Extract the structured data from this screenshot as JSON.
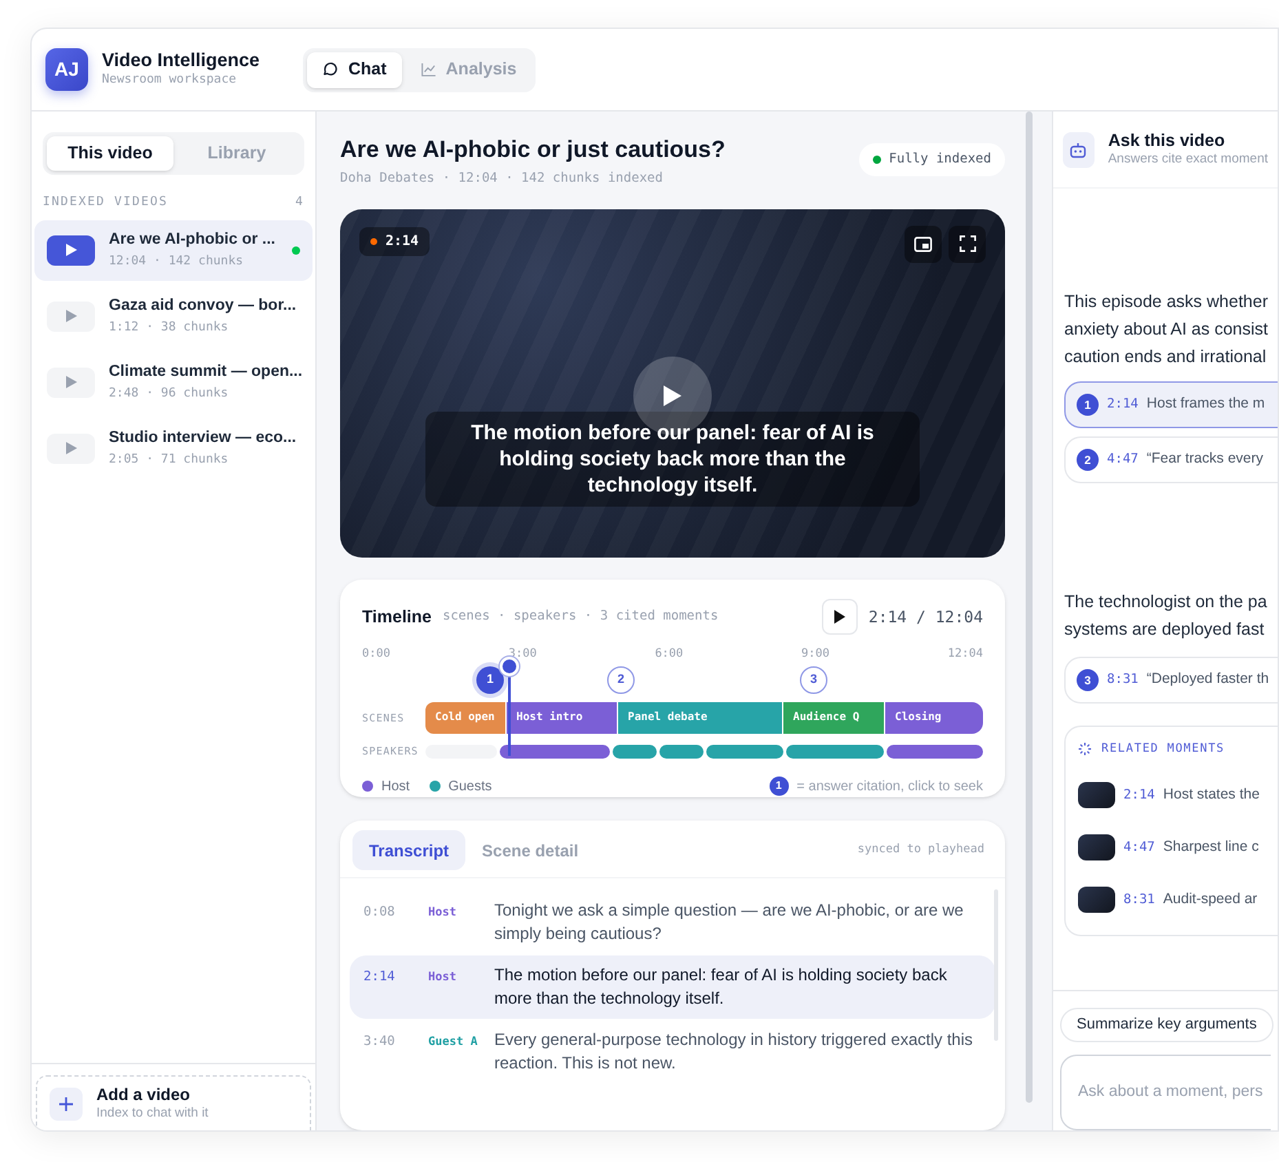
{
  "header": {
    "logo": "AJ",
    "title": "Video Intelligence",
    "subtitle": "Newsroom workspace",
    "tabs": [
      {
        "label": "Chat",
        "selected": true
      },
      {
        "label": "Analysis",
        "selected": false
      }
    ]
  },
  "sidebar": {
    "segments": [
      {
        "label": "This video",
        "selected": true
      },
      {
        "label": "Library",
        "selected": false
      }
    ],
    "section_title": "INDEXED VIDEOS",
    "count": "4",
    "videos": [
      {
        "title": "Are we AI-phobic or ...",
        "meta": "12:04 · 142 chunks",
        "selected": true
      },
      {
        "title": "Gaza aid convoy — bor...",
        "meta": "1:12 · 38 chunks",
        "selected": false
      },
      {
        "title": "Climate summit — open...",
        "meta": "2:48 · 96 chunks",
        "selected": false
      },
      {
        "title": "Studio interview — eco...",
        "meta": "2:05 · 71 chunks",
        "selected": false
      }
    ],
    "add": {
      "title": "Add a video",
      "subtitle": "Index to chat with it"
    }
  },
  "video": {
    "title": "Are we AI-phobic or just cautious?",
    "meta": "Doha Debates · 12:04 · 142 chunks indexed",
    "status": "Fully indexed",
    "timestamp": "2:14",
    "caption": "The motion before our panel: fear of AI is holding society back more than the technology itself."
  },
  "timeline": {
    "title": "Timeline",
    "summary": "scenes · speakers · 3 cited moments",
    "time": "2:14 / 12:04",
    "ticks": [
      "0:00",
      "3:00",
      "6:00",
      "9:00",
      "12:04"
    ],
    "scenes_label": "SCENES",
    "speakers_label": "SPEAKERS",
    "scenes": [
      {
        "label": "Cold open",
        "color": "#e48b4a"
      },
      {
        "label": "Host intro",
        "color": "#7b5fd6"
      },
      {
        "label": "Panel debate",
        "color": "#27a4a8"
      },
      {
        "label": "Audience Q",
        "color": "#2fa65c"
      },
      {
        "label": "Closing",
        "color": "#7b5fd6"
      }
    ],
    "speaker_segments": [
      {
        "kind": "none"
      },
      {
        "kind": "host"
      },
      {
        "kind": "guest"
      },
      {
        "kind": "guest"
      },
      {
        "kind": "guest"
      },
      {
        "kind": "guest"
      },
      {
        "kind": "host"
      }
    ],
    "markers": [
      {
        "label": "1",
        "selected": true
      },
      {
        "label": "2",
        "selected": false
      },
      {
        "label": "3",
        "selected": false
      }
    ],
    "legend": [
      {
        "label": "Host",
        "color": "#7b5fd6"
      },
      {
        "label": "Guests",
        "color": "#27a4a8"
      }
    ],
    "hint_marker": "1",
    "hint": "= answer citation, click to seek"
  },
  "transcript": {
    "tabs": [
      {
        "label": "Transcript",
        "selected": true
      },
      {
        "label": "Scene detail",
        "selected": false
      }
    ],
    "sync_note": "synced to playhead",
    "rows": [
      {
        "time": "0:08",
        "speaker": "Host",
        "kind": "host",
        "text": "Tonight we ask a simple question — are we AI-phobic, or are we simply being cautious?",
        "selected": false
      },
      {
        "time": "2:14",
        "speaker": "Host",
        "kind": "host",
        "text": "The motion before our panel: fear of AI is holding society back more than the technology itself.",
        "selected": true
      },
      {
        "time": "3:40",
        "speaker": "Guest A",
        "kind": "guest",
        "text": "Every general-purpose technology in history triggered exactly this reaction. This is not new.",
        "selected": false
      }
    ]
  },
  "chat": {
    "title": "Ask this video",
    "subtitle": "Answers cite exact moment",
    "messages": [
      {
        "kind": "paragraph",
        "lines": [
          "This episode asks whether",
          "anxiety about AI as consist",
          "caution ends and irrational"
        ]
      },
      {
        "kind": "citation",
        "number": "1",
        "time": "2:14",
        "text": "Host frames the m",
        "selected": true
      },
      {
        "kind": "citation",
        "number": "2",
        "time": "4:47",
        "text": "“Fear tracks every",
        "selected": false
      },
      {
        "kind": "paragraph",
        "lines": [
          "The technologist on the pa",
          "systems are deployed fast"
        ]
      },
      {
        "kind": "citation",
        "number": "3",
        "time": "8:31",
        "text": "“Deployed faster th",
        "selected": false
      },
      {
        "kind": "related",
        "title": "RELATED MOMENTS",
        "items": [
          {
            "time": "2:14",
            "text": "Host states the"
          },
          {
            "time": "4:47",
            "text": "Sharpest line c"
          },
          {
            "time": "8:31",
            "text": "Audit-speed ar"
          }
        ]
      }
    ],
    "suggestion": "Summarize key arguments",
    "input_placeholder": "Ask about a moment, pers"
  }
}
